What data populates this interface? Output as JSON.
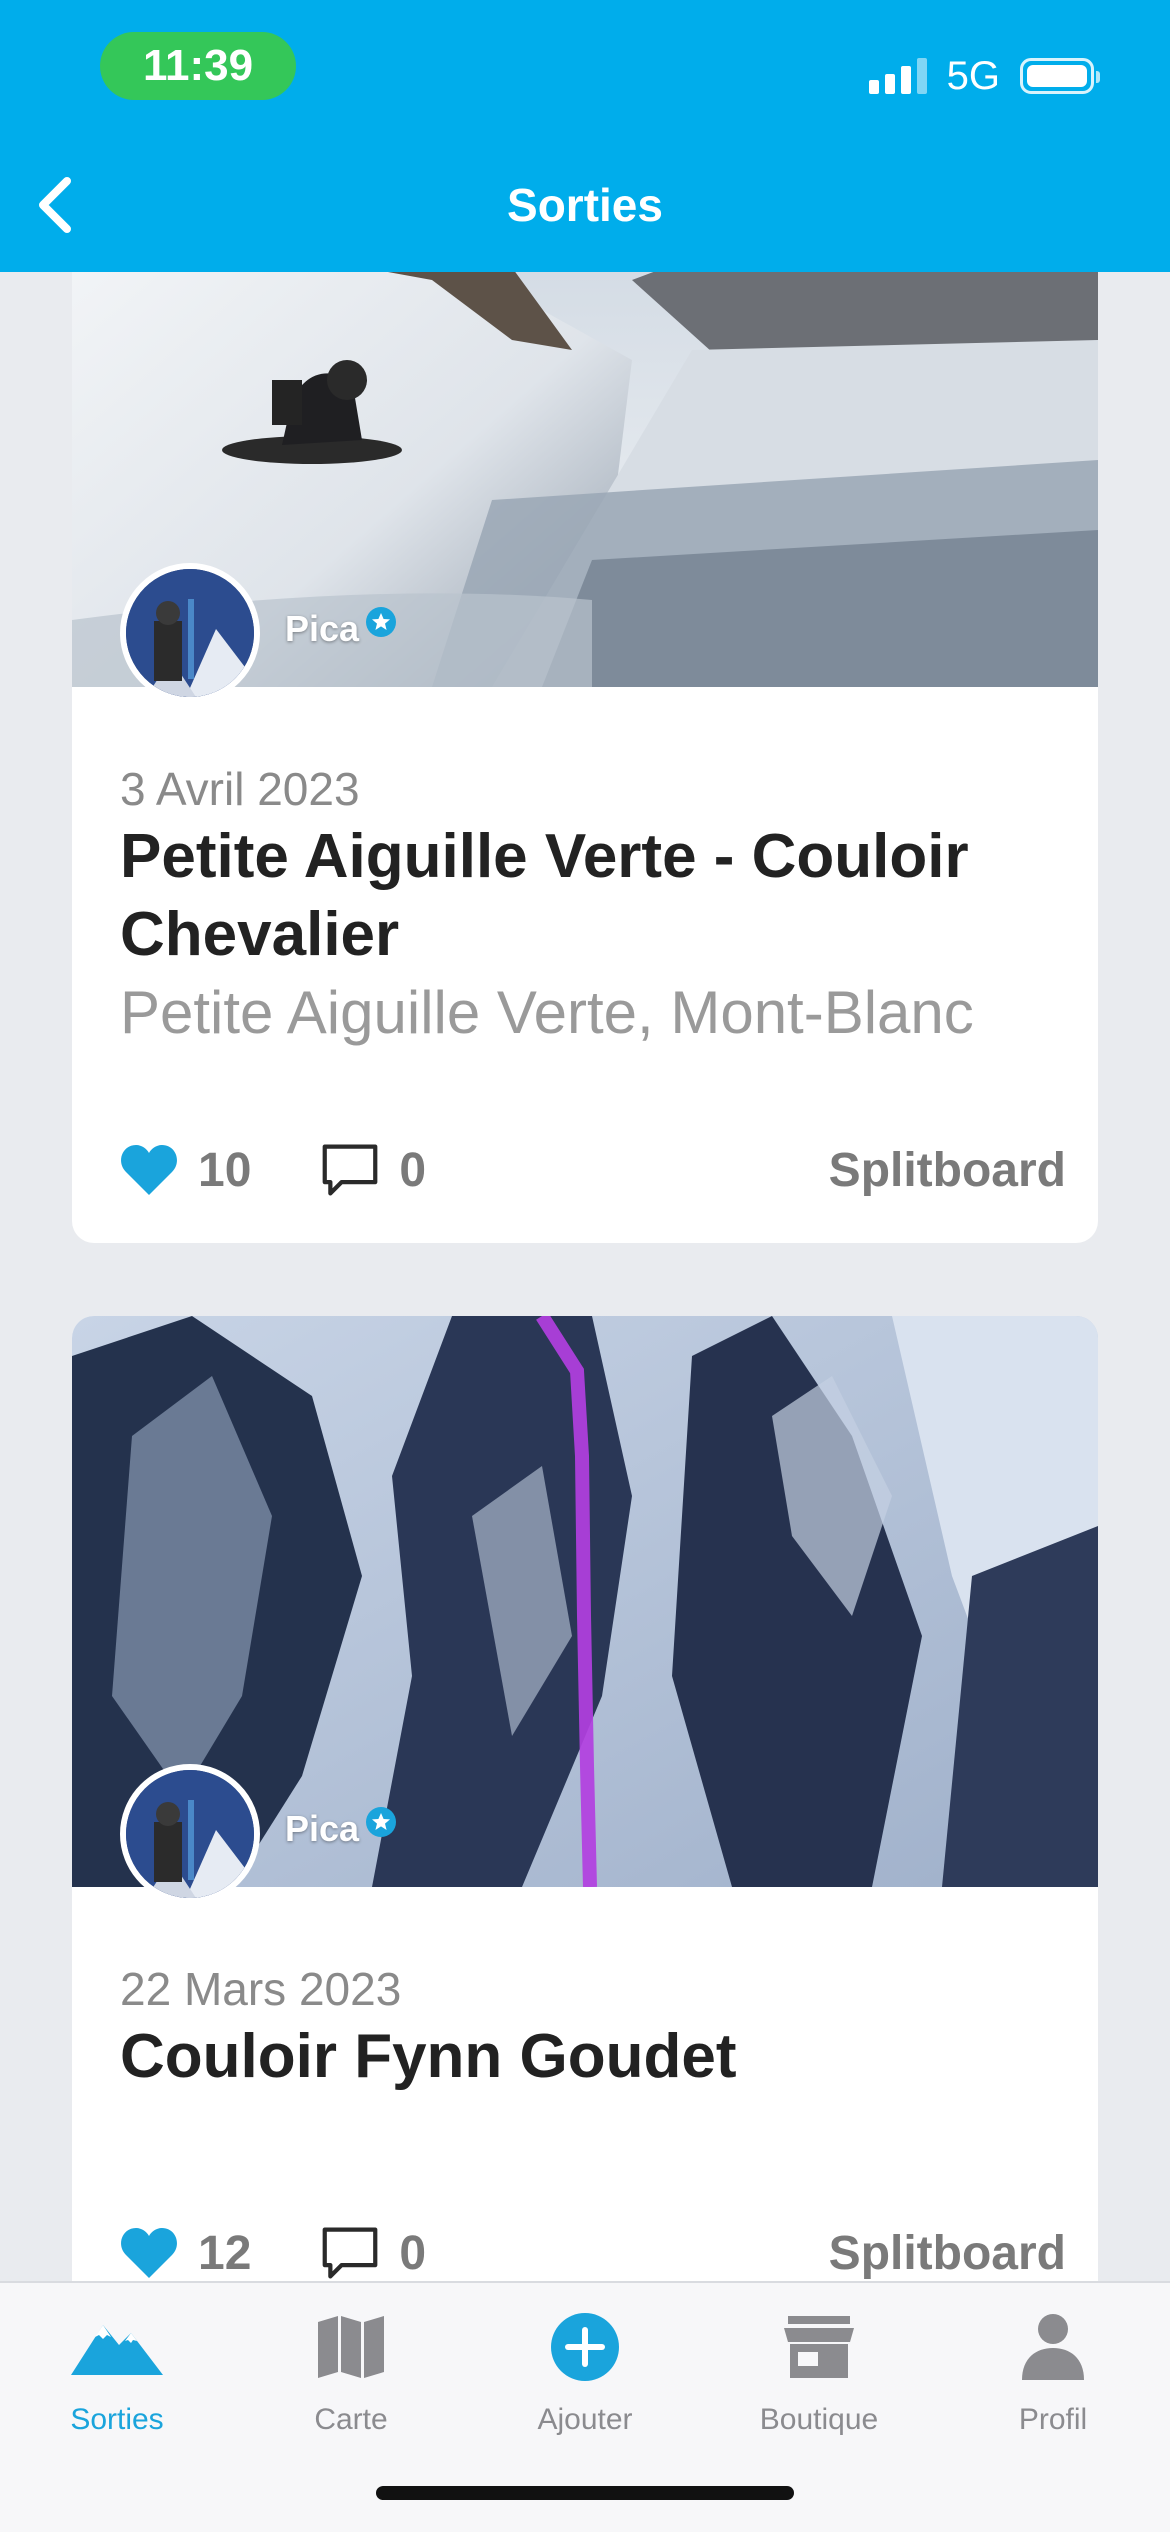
{
  "status": {
    "time": "11:39",
    "network": "5G"
  },
  "header": {
    "title": "Sorties",
    "back_icon": "chevron-left-icon"
  },
  "outings": [
    {
      "author": "Pica",
      "date": "3 Avril 2023",
      "title": "Petite Aiguille Verte - Couloir Chevalier",
      "location": "Petite Aiguille Verte, Mont-Blanc",
      "likes": "10",
      "comments": "0",
      "activity": "Splitboard"
    },
    {
      "author": "Pica",
      "date": "22 Mars 2023",
      "title": "Couloir Fynn Goudet",
      "likes": "12",
      "comments": "0",
      "activity": "Splitboard"
    }
  ],
  "tabbar": {
    "tabs": [
      {
        "label": "Sorties",
        "icon": "mountain-icon",
        "active": true
      },
      {
        "label": "Carte",
        "icon": "map-icon",
        "active": false
      },
      {
        "label": "Ajouter",
        "icon": "add-circle-icon",
        "active": false
      },
      {
        "label": "Boutique",
        "icon": "store-icon",
        "active": false
      },
      {
        "label": "Profil",
        "icon": "person-icon",
        "active": false
      }
    ]
  },
  "colors": {
    "brand": "#00adeb",
    "like": "#1aa4dc",
    "tab_active": "#1aa4dc",
    "tab_inactive": "#8b8b8f",
    "route_line": "#b23fe0"
  }
}
